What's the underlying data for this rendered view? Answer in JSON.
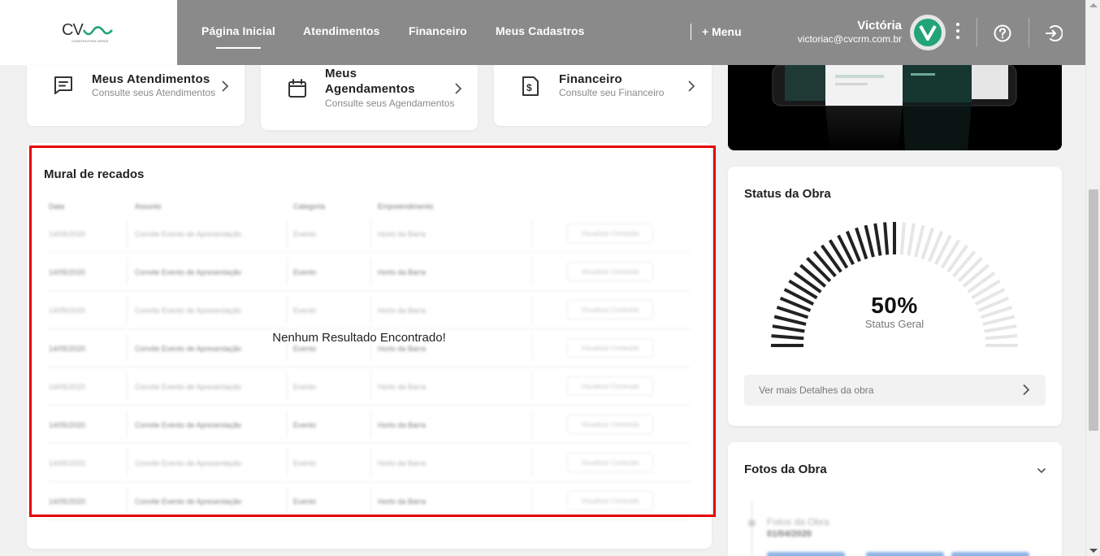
{
  "header": {
    "logo_text": "CV",
    "logo_tagline": "CONSTRUTORA VERDE",
    "nav": [
      {
        "label": "Página Inicial"
      },
      {
        "label": "Atendimentos"
      },
      {
        "label": "Financeiro"
      },
      {
        "label": "Meus Cadastros"
      }
    ],
    "more_menu": "+ Menu",
    "user": {
      "name": "Victória",
      "email": "victoriac@cvcrm.com.br",
      "avatar_letter": "V"
    },
    "icons": [
      "kebab-menu-icon",
      "help-icon",
      "logout-icon"
    ]
  },
  "shortcuts": [
    {
      "title": "Meus Atendimentos",
      "subtitle": "Consulte seus Atendimentos",
      "icon": "message-icon"
    },
    {
      "title": "Meus Agendamentos",
      "subtitle": "Consulte seus Agendamentos",
      "icon": "calendar-icon"
    },
    {
      "title": "Financeiro",
      "subtitle": "Consulte seu Financeiro",
      "icon": "finance-document-icon"
    }
  ],
  "mural": {
    "title": "Mural de recados",
    "empty_message": "Nenhum Resultado Encontrado!",
    "placeholder_columns": [
      "Data",
      "Assunto",
      "Categoria",
      "Empreendimento"
    ],
    "placeholder_row": {
      "date": "14/05/2020",
      "subject": "Convite Evento de Apresentação",
      "category": "Evento",
      "development": "Horto da Barra",
      "action": "Visualizar Conteúdo"
    },
    "placeholder_row_count": 8
  },
  "status_obra": {
    "title": "Status da Obra",
    "percent": "50%",
    "progress": 0.5,
    "label": "Status Geral",
    "details_link": "Ver mais Detalhes da obra",
    "colors": {
      "filled": "#222222",
      "empty": "#e6e6e6"
    }
  },
  "fotos_obra": {
    "title": "Fotos da Obra",
    "item_title": "Fotos da Obra",
    "item_date": "01/04/2020"
  },
  "colors": {
    "topbar": "#8a8a8a",
    "accent_green": "#22a37a",
    "highlight_red": "#e60000"
  }
}
